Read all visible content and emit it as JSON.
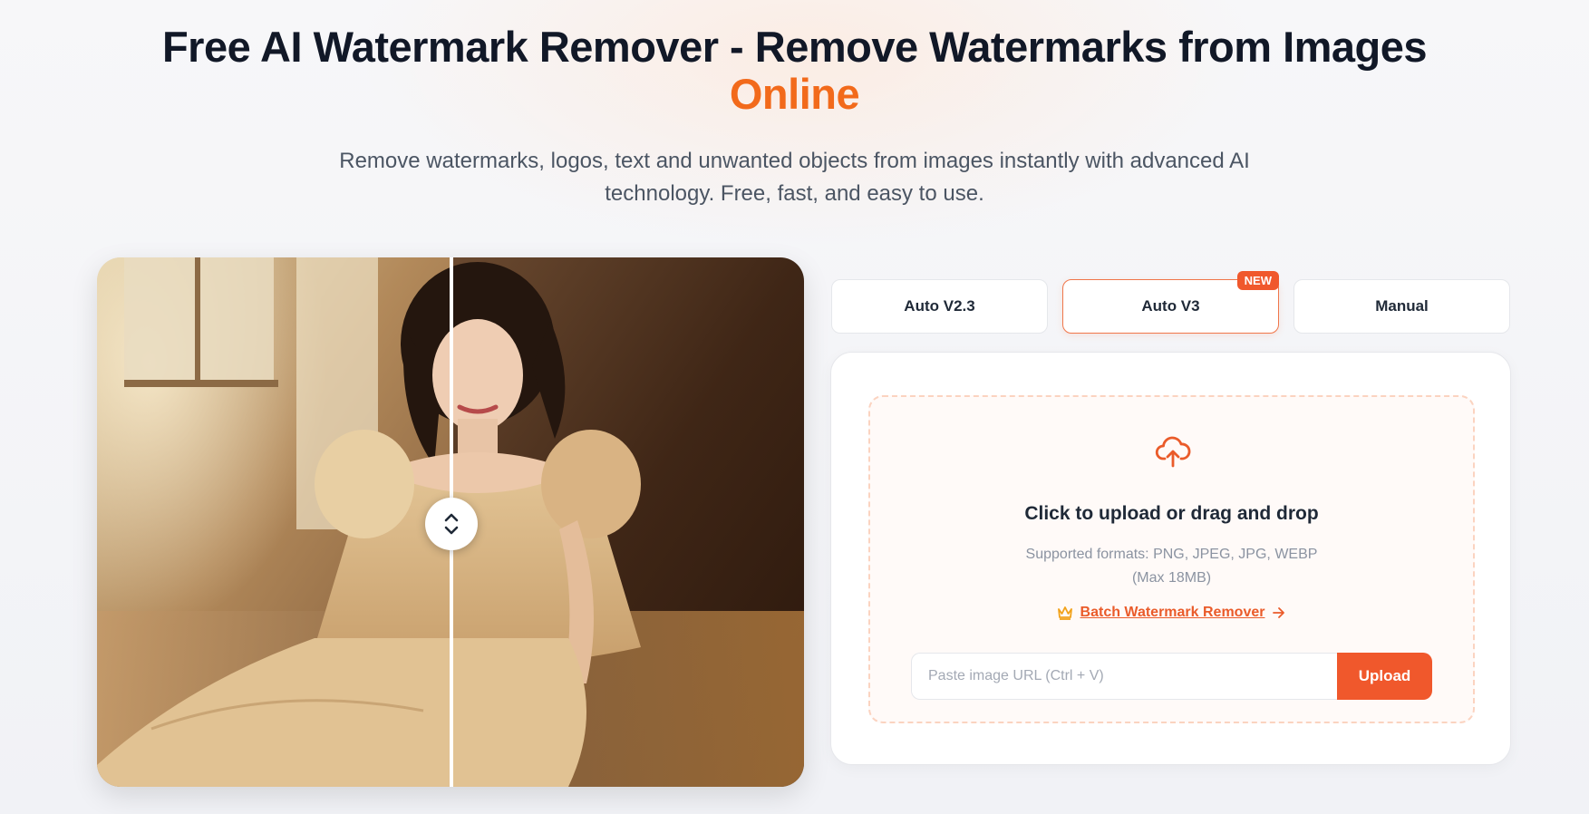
{
  "hero": {
    "title_main": "Free AI Watermark Remover - Remove Watermarks from Images",
    "title_accent": "Online",
    "subtitle": "Remove watermarks, logos, text and unwanted objects from images instantly with advanced AI technology. Free, fast, and easy to use."
  },
  "comparison": {
    "handle_icon": "chevron-up-down-icon"
  },
  "tabs": [
    {
      "label": "Auto V2.3",
      "active": false
    },
    {
      "label": "Auto V3",
      "active": true,
      "badge": "NEW"
    },
    {
      "label": "Manual",
      "active": false
    }
  ],
  "upload": {
    "icon": "cloud-upload-icon",
    "title": "Click to upload or drag and drop",
    "formats_line1": "Supported formats: PNG, JPEG, JPG, WEBP",
    "formats_line2": "(Max 18MB)",
    "batch_icon": "crown-icon",
    "batch_label": "Batch Watermark Remover",
    "batch_arrow_icon": "arrow-right-icon",
    "url_placeholder": "Paste image URL (Ctrl + V)",
    "upload_button": "Upload"
  },
  "colors": {
    "accent": "#f26a1b",
    "button": "#f0582c",
    "title": "#111827"
  }
}
